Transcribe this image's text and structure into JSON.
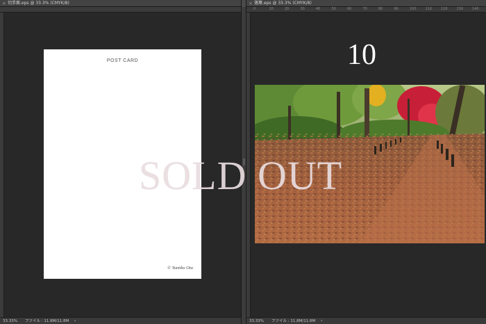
{
  "left_doc": {
    "tab_title": "切手面.eps @ 33.3% (CMYK/8)",
    "close_glyph": "×",
    "status": {
      "zoom": "33.33%",
      "file_info": "ファイル : 11.8M/11.8M",
      "arrow": "›"
    },
    "postcard": {
      "title": "POST CARD",
      "copyright": "© Yumiko Ota"
    }
  },
  "right_doc": {
    "tab_title": "落葉.eps @ 33.3% (CMYK/8)",
    "close_glyph": "×",
    "status": {
      "zoom": "33.33%",
      "file_info": "ファイル : 11.8M/11.8M",
      "arrow": "›"
    },
    "ruler_ticks": [
      "0",
      "10",
      "20",
      "30",
      "40",
      "50",
      "60",
      "70",
      "80",
      "90",
      "100",
      "110",
      "120",
      "130",
      "140"
    ],
    "number_label": "10",
    "photo": {
      "subject": "autumn-leaves-path-photo"
    }
  },
  "overlay": {
    "sold_out": "SOLD OUT"
  },
  "colors": {
    "workspace": "#282828",
    "panel": "#434343",
    "sold_out_text": "#eadde0",
    "maple_red": "#c81f38",
    "leaf_carpet": "#9a5a3e"
  }
}
